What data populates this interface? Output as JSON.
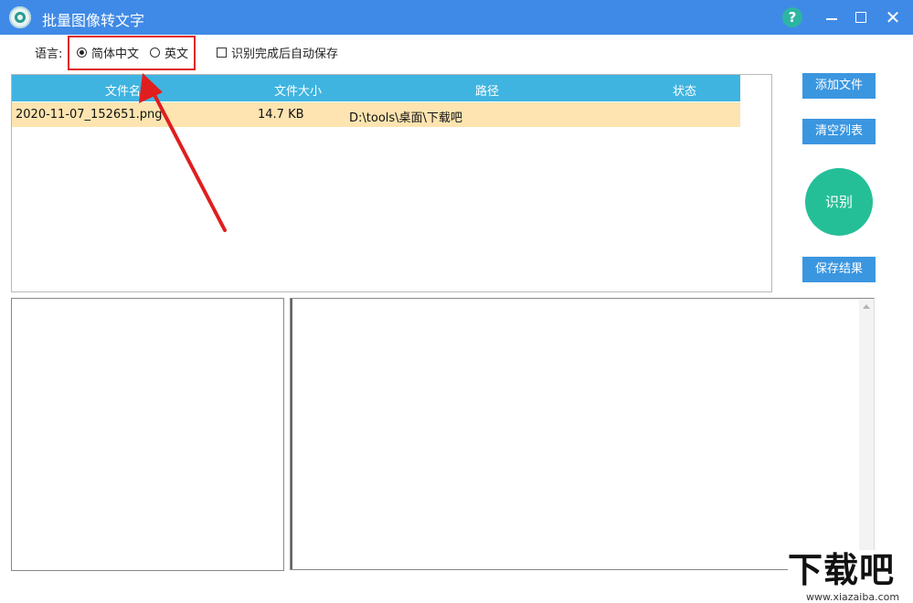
{
  "window": {
    "title": "批量图像转文字",
    "help_label": "?",
    "close_label": "✕"
  },
  "options": {
    "language_label": "语言:",
    "lang_zh": "简体中文",
    "lang_en": "英文",
    "lang_selected": "简体中文",
    "autosave_label": "识别完成后自动保存",
    "autosave_checked": false
  },
  "table": {
    "columns": [
      "文件名",
      "文件大小",
      "路径",
      "状态"
    ],
    "rows": [
      {
        "name": "2020-11-07_152651.png",
        "size": "14.7 KB",
        "path": "D:\\tools\\桌面\\下载吧",
        "status": ""
      }
    ]
  },
  "actions": {
    "add_file": "添加文件",
    "clear_list": "清空列表",
    "recognize": "识别",
    "save_result": "保存结果"
  },
  "watermark": {
    "logo_text": "下载吧",
    "url": "www.xiazaiba.com"
  },
  "colors": {
    "titlebar": "#3f8ae6",
    "table_header": "#3fb4e0",
    "row_highlight": "#fde4b0",
    "button": "#3b96e0",
    "recognize": "#25bf97",
    "annotation": "#e01e1e"
  }
}
